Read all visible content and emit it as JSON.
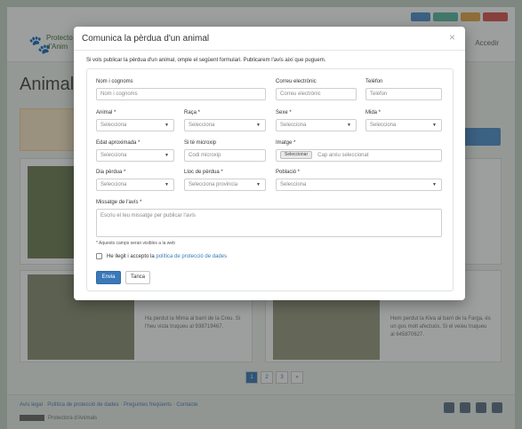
{
  "background": {
    "logo_line1": "Protecto",
    "logo_line2": "d'Anim",
    "page_title": "Animals",
    "accedir": "Accedir",
    "footer_links": "Avís legal · Política de protecció de dades · Preguntes freqüents · Contacte",
    "footer_copy": "Protectora d'Animals",
    "pagination": [
      "1",
      "2",
      "3",
      "»"
    ],
    "card1_text": "Ha perdut la Mima al barri de la Creu. Si l'heu vista truqueu al 938719467.",
    "card2_text": "Hem perdut la Kiva al barri de la Farga, és un gos molt afectuós. Si el veieu truqueu al 645870627."
  },
  "modal": {
    "title": "Comunica la pèrdua d'un animal",
    "close": "×",
    "intro": "Si vols publicar la pèrdua d'un animal, omple el següent formulari. Publicarem l'avís així que puguem.",
    "fields": {
      "name": {
        "label": "Nom i cognoms",
        "placeholder": "Nom i cognoms"
      },
      "email": {
        "label": "Correu electrònic",
        "placeholder": "Correu electrònic"
      },
      "phone": {
        "label": "Telèfon",
        "placeholder": "Telèfon"
      },
      "animal": {
        "label": "Animal *",
        "value": "Selecciona"
      },
      "breed": {
        "label": "Raça *",
        "value": "Selecciona"
      },
      "sex": {
        "label": "Sexe *",
        "value": "Selecciona"
      },
      "size": {
        "label": "Mida *",
        "value": "Selecciona"
      },
      "age": {
        "label": "Edat aproximada *",
        "value": "Selecciona"
      },
      "microchip": {
        "label": "Si té microxip",
        "placeholder": "Codi microxip"
      },
      "image": {
        "label": "Imatge *",
        "button": "Seleccionar",
        "status": "Cap arxiu seleccionat"
      },
      "date": {
        "label": "Dia pèrdua *",
        "value": "Selecciona"
      },
      "place": {
        "label": "Lloc de pèrdua *",
        "value": "Selecciona provincia"
      },
      "town": {
        "label": "Població *",
        "value": "Selecciona"
      },
      "message": {
        "label": "Missatge de l'avís *",
        "placeholder": "Escriu el teu missatge per publicar l'avís"
      }
    },
    "visible_note": "* Aquests camps seran visibles a la web",
    "consent_text": "He llegit i accepto la ",
    "consent_link": "política de protecció de dades",
    "submit": "Envia",
    "cancel": "Tanca"
  },
  "colors": {
    "primary": "#3a78b8",
    "link": "#3a78b8",
    "overlay": "rgba(35,42,40,0.45)"
  },
  "icons": {
    "select_arrow": "chevron-down-icon",
    "close": "close-icon"
  }
}
